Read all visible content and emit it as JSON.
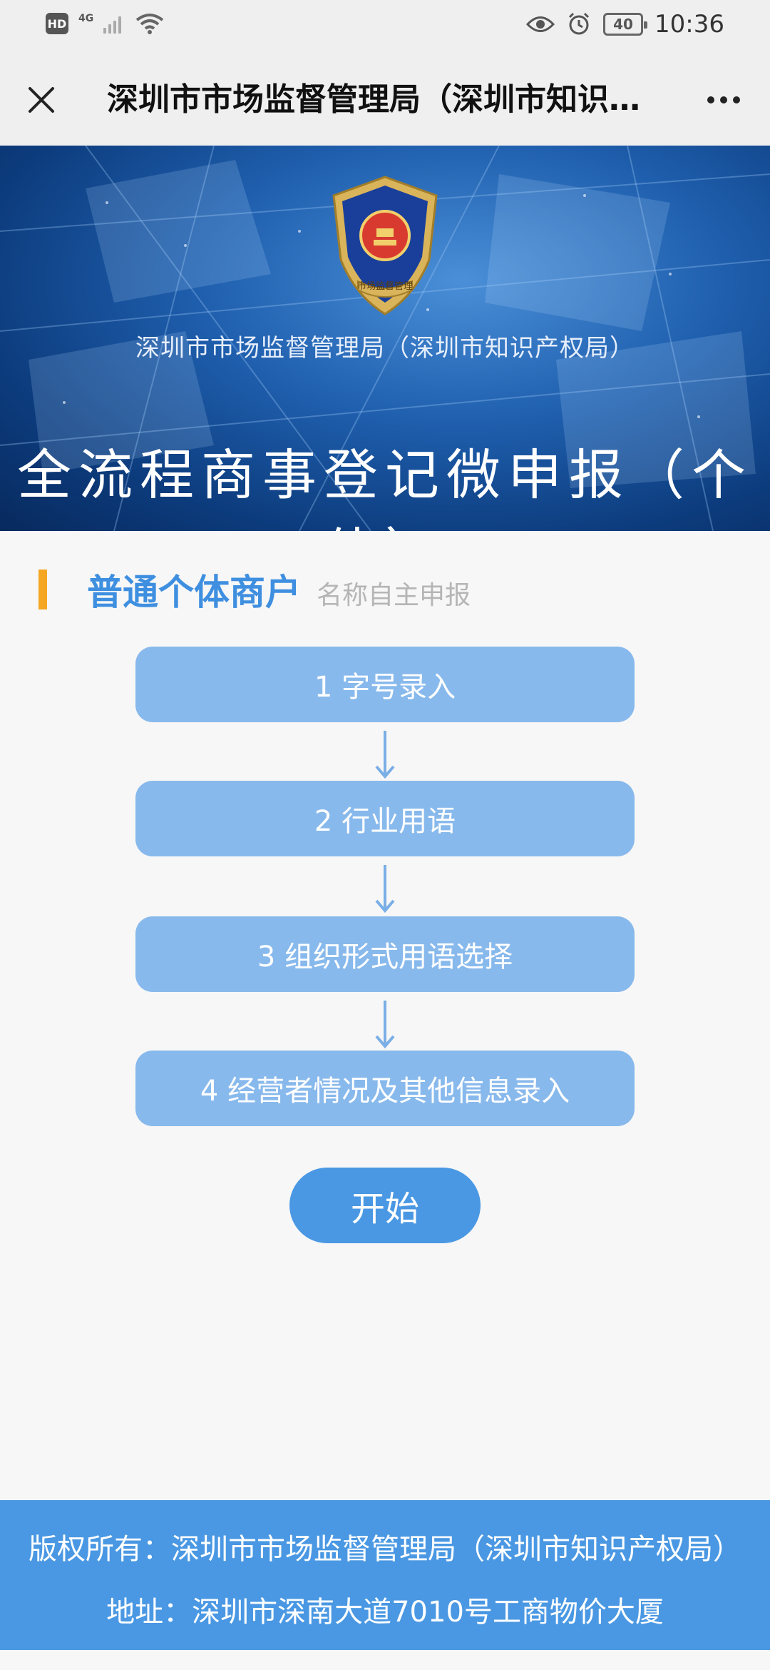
{
  "status_bar": {
    "hd": "HD",
    "network": "4G",
    "battery": "40",
    "time": "10:36"
  },
  "title_bar": {
    "title": "深圳市市场监督管理局（深圳市知识产权局）",
    "close_icon": "close-icon",
    "more_icon": "more-dots-icon"
  },
  "banner": {
    "org_name": "深圳市市场监督管理局（深圳市知识产权局）",
    "emblem_text": "市场监督管理",
    "title": "全流程商事登记微申报（个体）"
  },
  "section": {
    "title": "普通个体商户",
    "subtitle": "名称自主申报",
    "accent": "#f5a623"
  },
  "steps": [
    {
      "label": "1 字号录入"
    },
    {
      "label": "2 行业用语"
    },
    {
      "label": "3 组织形式用语选择"
    },
    {
      "label": "4 经营者情况及其他信息录入"
    }
  ],
  "start_button": {
    "label": "开始"
  },
  "footer": {
    "copyright": "版权所有：深圳市市场监督管理局（深圳市知识产权局）",
    "address": "地址：深圳市深南大道7010号工商物价大厦"
  },
  "colors": {
    "step_bg": "#88b9ec",
    "primary": "#4a98e3",
    "section_title": "#3f8fe0"
  }
}
